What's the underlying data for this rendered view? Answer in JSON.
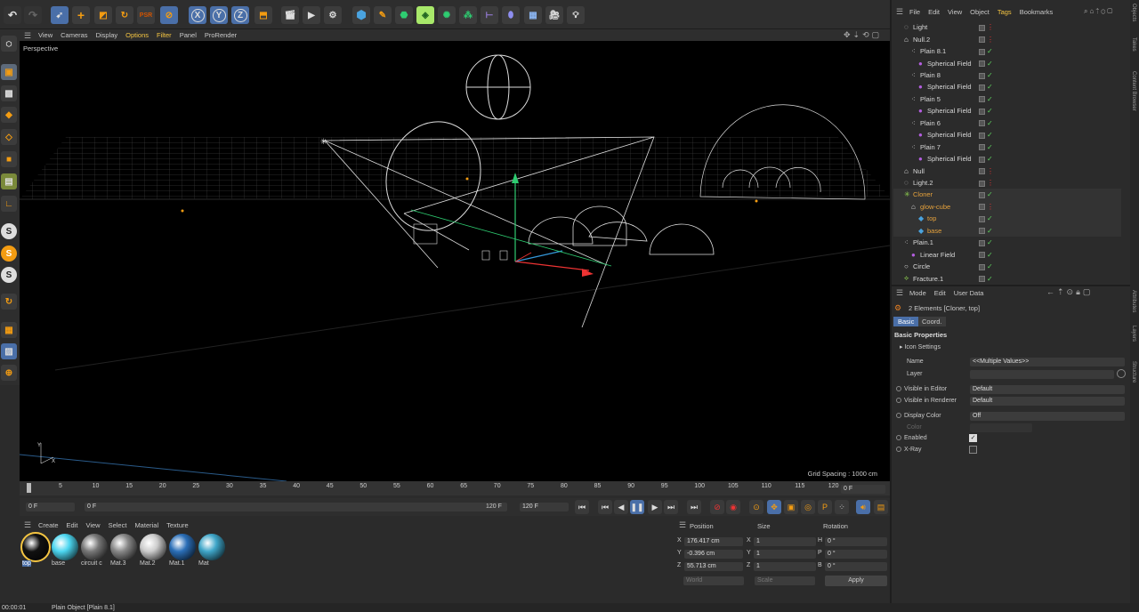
{
  "viewport_menu": [
    "View",
    "Cameras",
    "Display",
    "Options",
    "Filter",
    "Panel",
    "ProRender"
  ],
  "viewport_active_menu": [
    "Options",
    "Filter"
  ],
  "viewport_label": "Perspective",
  "grid_spacing": "Grid Spacing : 1000 cm",
  "timeline_ticks": [
    "5",
    "10",
    "15",
    "20",
    "25",
    "30",
    "35",
    "40",
    "45",
    "50",
    "55",
    "60",
    "65",
    "70",
    "75",
    "80",
    "85",
    "90",
    "95",
    "100",
    "105",
    "110",
    "115",
    "120"
  ],
  "timeline_end_field": "0 F",
  "frame_start": "0 F",
  "frame_current": "0 F",
  "frame_range_end": "120 F",
  "frame_max": "120 F",
  "material_menu": [
    "Create",
    "Edit",
    "View",
    "Select",
    "Material",
    "Texture"
  ],
  "materials": [
    {
      "name": "top",
      "color": "#111",
      "selected": true
    },
    {
      "name": "base",
      "color": "#4cd6f0"
    },
    {
      "name": "circuit c",
      "color": "#777"
    },
    {
      "name": "Mat.3",
      "color": "#888"
    },
    {
      "name": "Mat.2",
      "color": "#ccc"
    },
    {
      "name": "Mat.1",
      "color": "#2b6fb8"
    },
    {
      "name": "Mat",
      "color": "#3fa6c9"
    }
  ],
  "coord": {
    "headers": [
      "Position",
      "Size",
      "Rotation"
    ],
    "rows": [
      {
        "axis": "X",
        "pos": "176.417 cm",
        "saxis": "X",
        "size": "1",
        "raxis": "H",
        "rot": "0 °"
      },
      {
        "axis": "Y",
        "pos": "-0.396 cm",
        "saxis": "Y",
        "size": "1",
        "raxis": "P",
        "rot": "0 °"
      },
      {
        "axis": "Z",
        "pos": "55.713 cm",
        "saxis": "Z",
        "size": "1",
        "raxis": "B",
        "rot": "0 °"
      }
    ],
    "mode1": "World",
    "mode2": "Scale",
    "apply": "Apply"
  },
  "status": {
    "time": "00:00:01",
    "text": "Plain Object [Plain 8.1]"
  },
  "om_menu": [
    "File",
    "Edit",
    "View",
    "Object",
    "Tags",
    "Bookmarks"
  ],
  "om_active": "Tags",
  "objects": [
    {
      "name": "Light",
      "indent": 0,
      "icon": "light"
    },
    {
      "name": "Null.2",
      "indent": 0,
      "icon": "null"
    },
    {
      "name": "Plain 8.1",
      "indent": 1,
      "icon": "plain"
    },
    {
      "name": "Spherical Field",
      "indent": 2,
      "icon": "field"
    },
    {
      "name": "Plain 8",
      "indent": 1,
      "icon": "plain"
    },
    {
      "name": "Spherical Field",
      "indent": 2,
      "icon": "field"
    },
    {
      "name": "Plain 5",
      "indent": 1,
      "icon": "plain"
    },
    {
      "name": "Spherical Field",
      "indent": 2,
      "icon": "field"
    },
    {
      "name": "Plain 6",
      "indent": 1,
      "icon": "plain"
    },
    {
      "name": "Spherical Field",
      "indent": 2,
      "icon": "field"
    },
    {
      "name": "Plain 7",
      "indent": 1,
      "icon": "plain"
    },
    {
      "name": "Spherical Field",
      "indent": 2,
      "icon": "field"
    },
    {
      "name": "Null",
      "indent": 0,
      "icon": "null"
    },
    {
      "name": "Light.2",
      "indent": 0,
      "icon": "light"
    },
    {
      "name": "Cloner",
      "indent": 0,
      "icon": "cloner",
      "color": "#e6a23c"
    },
    {
      "name": "glow-cube",
      "indent": 1,
      "icon": "null",
      "color": "#e6a23c"
    },
    {
      "name": "top",
      "indent": 2,
      "icon": "cube",
      "color": "#e6a23c"
    },
    {
      "name": "base",
      "indent": 2,
      "icon": "cube",
      "color": "#e6a23c"
    },
    {
      "name": "Plain.1",
      "indent": 0,
      "icon": "plain"
    },
    {
      "name": "Linear Field",
      "indent": 1,
      "icon": "field"
    },
    {
      "name": "Circle",
      "indent": 0,
      "icon": "circle"
    },
    {
      "name": "Fracture.1",
      "indent": 0,
      "icon": "fracture"
    }
  ],
  "side_tabs_top": [
    "Objects",
    "Takes",
    "Content Browser"
  ],
  "side_tabs_bottom": [
    "Attributes",
    "Layers",
    "Structure"
  ],
  "attr_menu": [
    "Mode",
    "Edit",
    "User Data"
  ],
  "attr_title": "2 Elements [Cloner, top]",
  "attr_tabs": [
    "Basic",
    "Coord."
  ],
  "attr_section": "Basic Properties",
  "attr_subsection": "Icon Settings",
  "attributes": {
    "name_label": "Name",
    "name_value": "<<Multiple Values>>",
    "layer_label": "Layer",
    "vis_editor_label": "Visible in Editor",
    "vis_editor_value": "Default",
    "vis_render_label": "Visible in Renderer",
    "vis_render_value": "Default",
    "display_color_label": "Display Color",
    "display_color_value": "Off",
    "color_label": "Color",
    "enabled_label": "Enabled",
    "xray_label": "X-Ray"
  },
  "toolbar_icons": [
    "undo-icon",
    "redo-icon",
    "select-icon",
    "move-icon",
    "scale-icon",
    "rotate-icon",
    "psr-icon",
    "live-select-icon",
    "x-axis-icon",
    "y-axis-icon",
    "z-axis-icon",
    "coord-system-icon",
    "render-region-icon",
    "render-view-icon",
    "render-settings-icon",
    "cube-icon",
    "pen-icon",
    "subdivision-icon",
    "cloner-icon",
    "hair-icon",
    "mograph-icon",
    "deformer-icon",
    "field-icon",
    "grid-icon",
    "camera-icon",
    "light-icon"
  ],
  "toolbar_letters": {
    "x": "X",
    "y": "Y",
    "z": "Z"
  }
}
